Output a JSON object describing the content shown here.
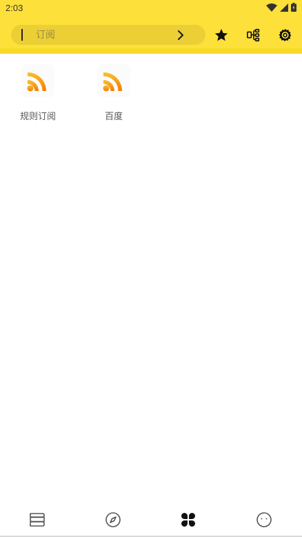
{
  "status_bar": {
    "time": "2:03",
    "icons": [
      "wifi-icon",
      "cell-signal-icon",
      "battery-icon"
    ]
  },
  "top_bar": {
    "search": {
      "placeholder": "订阅",
      "value": ""
    },
    "actions": [
      "go-arrow-icon",
      "star-icon",
      "rule-sources-icon",
      "settings-icon"
    ],
    "background_color": "#fde03a",
    "search_color": "#eccf35"
  },
  "subscriptions": [
    {
      "label": "规则订阅",
      "icon": "rss-icon"
    },
    {
      "label": "百度",
      "icon": "rss-icon"
    }
  ],
  "rss_colors": {
    "top": "#fbc02d",
    "bottom": "#f57c00"
  },
  "bottom_nav": {
    "items": [
      {
        "name": "bookshelf",
        "icon": "bookshelf-icon"
      },
      {
        "name": "discover",
        "icon": "compass-icon"
      },
      {
        "name": "rss",
        "icon": "clover-icon",
        "selected": true
      },
      {
        "name": "my",
        "icon": "face-icon"
      }
    ]
  }
}
